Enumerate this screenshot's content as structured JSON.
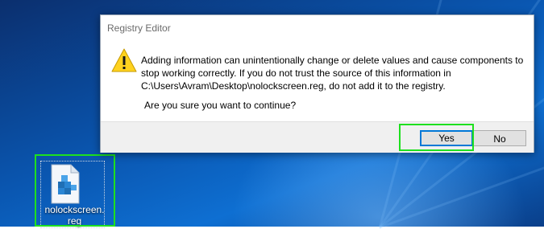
{
  "dialog": {
    "title": "Registry Editor",
    "icon": "warning-icon",
    "message_line1": "Adding information can unintentionally change or delete values and cause components to",
    "message_line2": "stop working correctly. If you do not trust the source of this information in",
    "message_line3": "C:\\Users\\Avram\\Desktop\\nolockscreen.reg, do not add it to the registry.",
    "question": "Are you sure you want to continue?",
    "buttons": {
      "yes": "Yes",
      "no": "No"
    }
  },
  "desktop": {
    "icon": {
      "name": "registry-file-icon",
      "label_line1": "nolockscreen.",
      "label_line2": "reg"
    }
  },
  "colors": {
    "highlight": "#1ee01e",
    "accent": "#0078d7"
  }
}
